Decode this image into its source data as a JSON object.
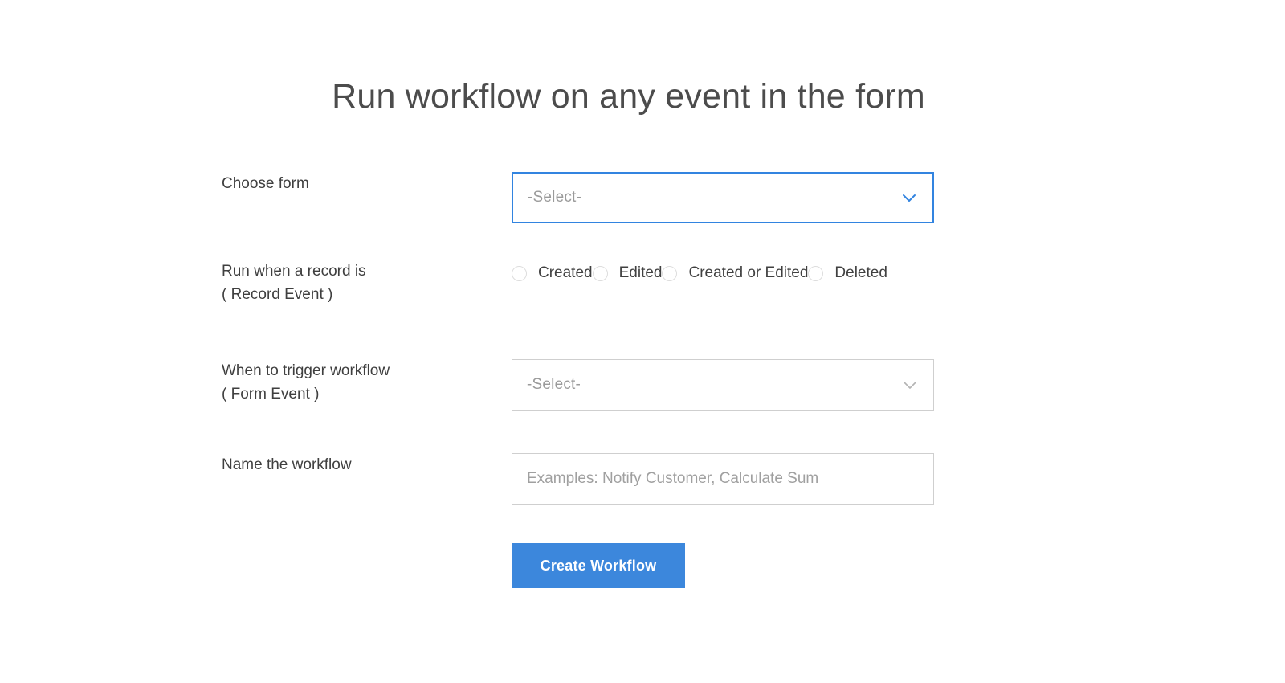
{
  "page": {
    "title": "Run workflow on any event in the form",
    "accent_color": "#3c87dc",
    "focus_border_color": "#3284e0"
  },
  "form": {
    "choose_form": {
      "label": "Choose form",
      "select_value": "-Select-",
      "chevron_icon": "chevron-down-icon",
      "focused": true
    },
    "record_event": {
      "label_line1": "Run when a record is",
      "label_line2": "( Record Event )",
      "options": [
        {
          "label": "Created",
          "selected": false
        },
        {
          "label": "Edited",
          "selected": false
        },
        {
          "label": "Created or Edited",
          "selected": false
        },
        {
          "label": "Deleted",
          "selected": false
        }
      ]
    },
    "form_event": {
      "label_line1": "When to trigger workflow",
      "label_line2": "( Form Event )",
      "select_value": "-Select-",
      "chevron_icon": "chevron-down-icon",
      "focused": false
    },
    "workflow_name": {
      "label": "Name the workflow",
      "value": "",
      "placeholder": "Examples: Notify Customer, Calculate Sum"
    },
    "submit": {
      "label": "Create Workflow"
    }
  }
}
